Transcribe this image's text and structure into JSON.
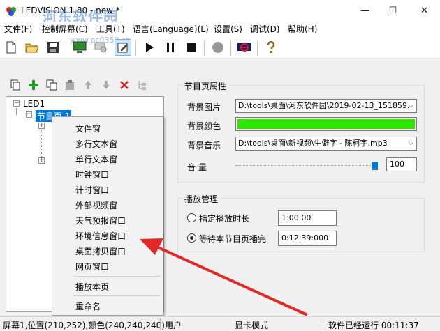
{
  "window": {
    "title": "LEDVISION 1.80 - new *",
    "minimize_glyph": "—",
    "maximize_glyph": "☐",
    "close_glyph": "✕"
  },
  "watermark": {
    "line1": "河东软件园",
    "line2": "www.pc0359.cn"
  },
  "menu": [
    "文件(F)",
    "控制屏幕(C)",
    "工具(T)",
    "语言(Language)(L)",
    "设置(S)",
    "调试(D)",
    "帮助(H)"
  ],
  "toolbar_icons": [
    "new-file-icon",
    "open-folder-icon",
    "save-icon",
    "screen-icon",
    "settings-icon",
    "edit-icon",
    "play-icon",
    "pause-icon",
    "stop-icon",
    "record-icon",
    "monitor-off-icon",
    "help-icon"
  ],
  "tree_toolbar_icons": [
    "new-page-icon",
    "add-icon",
    "copy-icon",
    "paste-icon",
    "move-up-icon",
    "move-down-icon",
    "delete-icon",
    "tree-structure-icon"
  ],
  "tree": {
    "root": "LED1",
    "page": "节目页 1"
  },
  "context_menu": {
    "items": [
      "文件窗",
      "多行文本窗",
      "单行文本窗",
      "时钟窗口",
      "计时窗口",
      "外部视频窗",
      "天气预报窗口",
      "环境信息窗口",
      "桌面拷贝窗口",
      "网页窗口"
    ],
    "play_page": "播放本页",
    "rename": "重命名"
  },
  "page_props": {
    "group_title": "节目页属性",
    "bg_image_label": "背景图片",
    "bg_image_value": "D:\\tools\\桌面\\河东软件园\\2019-02-13_151859.",
    "bg_color_label": "背景颜色",
    "bg_color": "#2ee600",
    "bg_music_label": "背景音乐",
    "bg_music_value": "D:\\tools\\桌面\\新视频\\生僻字 - 陈柯宇.mp3",
    "volume_label": "音    量",
    "volume_value": "100",
    "volume_fraction": 1.0
  },
  "playback": {
    "group_title": "播放管理",
    "opt1_label": "指定播放时长",
    "opt1_value": "1:00:00",
    "opt2_label": "等待本节目页播完",
    "opt2_value": "0:12:39:000",
    "selected": 2
  },
  "status": {
    "screen_info": "屏幕1,位置(210,252),颜色(240,240,240)",
    "user": "用户",
    "mode": "显卡模式",
    "runtime": "软件已经运行 00:11:37"
  }
}
